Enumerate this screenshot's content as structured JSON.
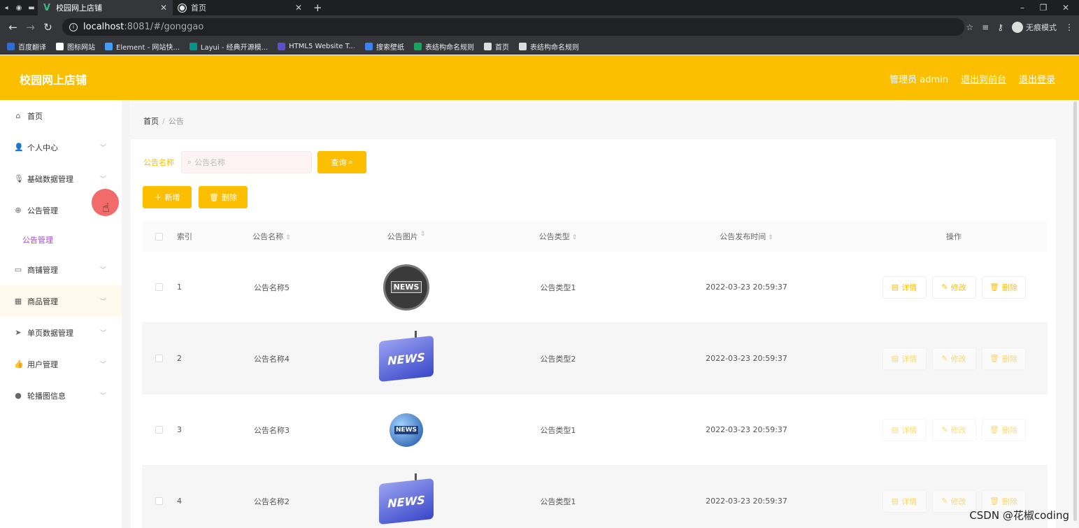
{
  "browser": {
    "tabs": [
      {
        "title": "校园网上店铺",
        "active": true,
        "icon": "vue-icon"
      },
      {
        "title": "首页",
        "active": false,
        "icon": "globe-icon"
      }
    ],
    "url_host": "localhost",
    "url_path": ":8081/#/gonggao",
    "incognito_label": "无痕模式",
    "bookmarks": [
      {
        "label": "百度翻译",
        "color": "#2f6bd8"
      },
      {
        "label": "图标网站",
        "color": "#ffffff"
      },
      {
        "label": "Element - 网站快...",
        "color": "#409eff"
      },
      {
        "label": "Layui - 经典开源模...",
        "color": "#009688"
      },
      {
        "label": "HTML5 Website T...",
        "color": "#5a4fcf"
      },
      {
        "label": "搜索壁纸",
        "color": "#3b82f6"
      },
      {
        "label": "表结构命名规则",
        "color": "#1aa260"
      },
      {
        "label": "首页",
        "color": "#dddddd"
      },
      {
        "label": "表结构命名规则",
        "color": "#dddddd"
      }
    ]
  },
  "header": {
    "title": "校园网上店铺",
    "user": "管理员 admin",
    "to_front": "退出到前台",
    "logout": "退出登录",
    "color": "#fcbf00"
  },
  "sidebar": {
    "items": [
      {
        "label": "首页",
        "icon": "home-icon",
        "chevron": ""
      },
      {
        "label": "个人中心",
        "icon": "user-icon",
        "chevron": "down"
      },
      {
        "label": "基础数据管理",
        "icon": "microphone-icon",
        "chevron": "down"
      },
      {
        "label": "公告管理",
        "icon": "target-icon",
        "chevron": "up"
      },
      {
        "label": "公告管理",
        "icon": "",
        "chevron": "",
        "sub": true
      },
      {
        "label": "商铺管理",
        "icon": "chat-icon",
        "chevron": "down"
      },
      {
        "label": "商品管理",
        "icon": "grid-icon",
        "chevron": "down",
        "hover": true
      },
      {
        "label": "单页数据管理",
        "icon": "send-icon",
        "chevron": "down"
      },
      {
        "label": "用户管理",
        "icon": "thumb-icon",
        "chevron": "down"
      },
      {
        "label": "轮播图信息",
        "icon": "location-icon",
        "chevron": "down"
      }
    ]
  },
  "breadcrumb": {
    "home": "首页",
    "current": "公告"
  },
  "search": {
    "label": "公告名称",
    "placeholder": "公告名称",
    "query_button": "查询"
  },
  "actions": {
    "add": "新增",
    "delete": "删除"
  },
  "table": {
    "columns": [
      "索引",
      "公告名称",
      "公告图片",
      "公告类型",
      "公告发布时间",
      "操作"
    ],
    "op_labels": {
      "detail": "详情",
      "edit": "修改",
      "delete": "删除"
    },
    "rows": [
      {
        "index": "1",
        "name": "公告名称5",
        "image": "news-globe-dark",
        "type": "公告类型1",
        "time": "2022-03-23 20:59:37"
      },
      {
        "index": "2",
        "name": "公告名称4",
        "image": "news-key-blue",
        "type": "公告类型2",
        "time": "2022-03-23 20:59:37"
      },
      {
        "index": "3",
        "name": "公告名称3",
        "image": "news-globe-blue",
        "type": "公告类型1",
        "time": "2022-03-23 20:59:37"
      },
      {
        "index": "4",
        "name": "公告名称2",
        "image": "news-key-blue",
        "type": "公告类型1",
        "time": "2022-03-23 20:59:37"
      }
    ]
  },
  "watermark": "CSDN @花椒coding"
}
